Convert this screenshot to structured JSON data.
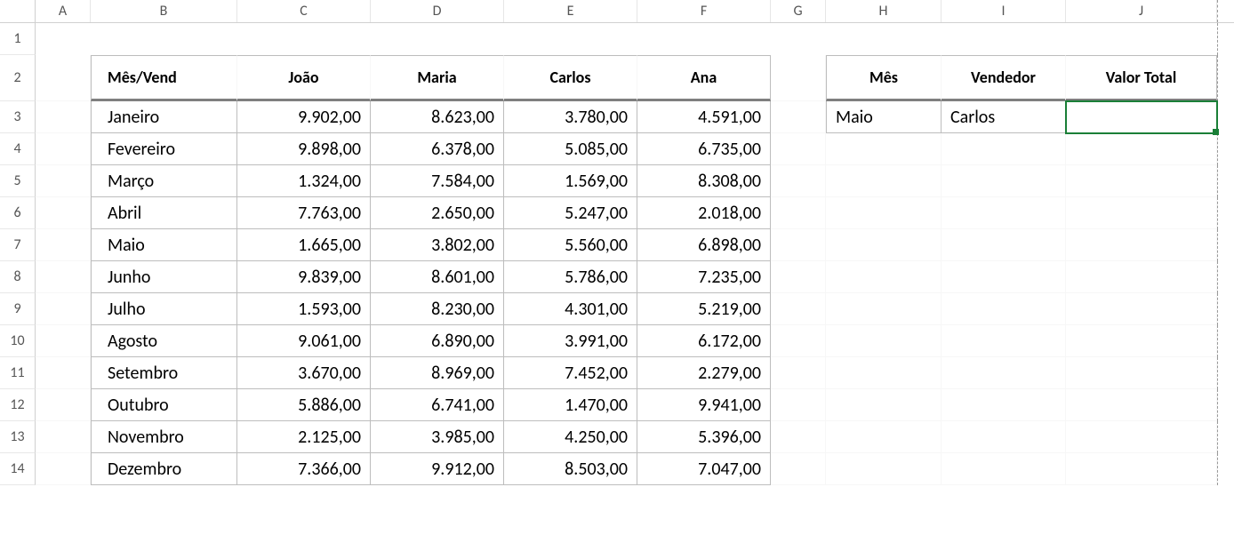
{
  "columns": [
    "A",
    "B",
    "C",
    "D",
    "E",
    "F",
    "G",
    "H",
    "I",
    "J"
  ],
  "row_numbers": [
    "1",
    "2",
    "3",
    "4",
    "5",
    "6",
    "7",
    "8",
    "9",
    "10",
    "11",
    "12",
    "13",
    "14"
  ],
  "main_table": {
    "corner_label": "Mês/Vend",
    "vendors": [
      "João",
      "Maria",
      "Carlos",
      "Ana"
    ],
    "rows": [
      {
        "month": "Janeiro",
        "values": [
          "9.902,00",
          "8.623,00",
          "3.780,00",
          "4.591,00"
        ]
      },
      {
        "month": "Fevereiro",
        "values": [
          "9.898,00",
          "6.378,00",
          "5.085,00",
          "6.735,00"
        ]
      },
      {
        "month": "Março",
        "values": [
          "1.324,00",
          "7.584,00",
          "1.569,00",
          "8.308,00"
        ]
      },
      {
        "month": "Abril",
        "values": [
          "7.763,00",
          "2.650,00",
          "5.247,00",
          "2.018,00"
        ]
      },
      {
        "month": "Maio",
        "values": [
          "1.665,00",
          "3.802,00",
          "5.560,00",
          "6.898,00"
        ]
      },
      {
        "month": "Junho",
        "values": [
          "9.839,00",
          "8.601,00",
          "5.786,00",
          "7.235,00"
        ]
      },
      {
        "month": "Julho",
        "values": [
          "1.593,00",
          "8.230,00",
          "4.301,00",
          "5.219,00"
        ]
      },
      {
        "month": "Agosto",
        "values": [
          "9.061,00",
          "6.890,00",
          "3.991,00",
          "6.172,00"
        ]
      },
      {
        "month": "Setembro",
        "values": [
          "3.670,00",
          "8.969,00",
          "7.452,00",
          "2.279,00"
        ]
      },
      {
        "month": "Outubro",
        "values": [
          "5.886,00",
          "6.741,00",
          "1.470,00",
          "9.941,00"
        ]
      },
      {
        "month": "Novembro",
        "values": [
          "2.125,00",
          "3.985,00",
          "4.250,00",
          "5.396,00"
        ]
      },
      {
        "month": "Dezembro",
        "values": [
          "7.366,00",
          "9.912,00",
          "8.503,00",
          "7.047,00"
        ]
      }
    ]
  },
  "lookup_table": {
    "headers": [
      "Mês",
      "Vendedor",
      "Valor Total"
    ],
    "row": {
      "mes": "Maio",
      "vendedor": "Carlos",
      "valor_total": ""
    }
  },
  "active_cell": "J3",
  "chart_data": {
    "type": "table",
    "title": "Mês/Vend",
    "columns": [
      "João",
      "Maria",
      "Carlos",
      "Ana"
    ],
    "rows": [
      "Janeiro",
      "Fevereiro",
      "Março",
      "Abril",
      "Maio",
      "Junho",
      "Julho",
      "Agosto",
      "Setembro",
      "Outubro",
      "Novembro",
      "Dezembro"
    ],
    "values": [
      [
        9902.0,
        8623.0,
        3780.0,
        4591.0
      ],
      [
        9898.0,
        6378.0,
        5085.0,
        6735.0
      ],
      [
        1324.0,
        7584.0,
        1569.0,
        8308.0
      ],
      [
        7763.0,
        2650.0,
        5247.0,
        2018.0
      ],
      [
        1665.0,
        3802.0,
        5560.0,
        6898.0
      ],
      [
        9839.0,
        8601.0,
        5786.0,
        7235.0
      ],
      [
        1593.0,
        8230.0,
        4301.0,
        5219.0
      ],
      [
        9061.0,
        6890.0,
        3991.0,
        6172.0
      ],
      [
        3670.0,
        8969.0,
        7452.0,
        2279.0
      ],
      [
        5886.0,
        6741.0,
        1470.0,
        9941.0
      ],
      [
        2125.0,
        3985.0,
        4250.0,
        5396.0
      ],
      [
        7366.0,
        9912.0,
        8503.0,
        7047.0
      ]
    ]
  }
}
